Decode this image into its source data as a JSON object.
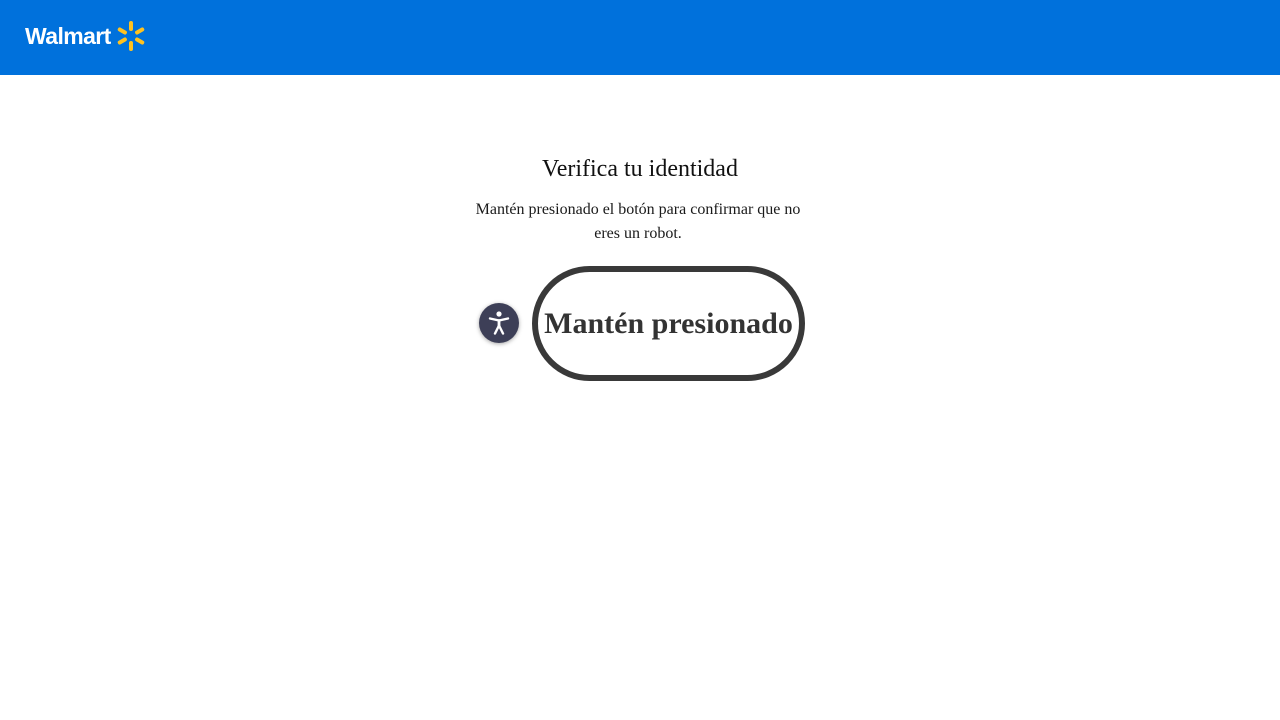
{
  "header": {
    "logo_text": "Walmart",
    "background_color": "#0071dc",
    "spark_icon": "spark-icon",
    "spark_color": "#ffc220"
  },
  "main": {
    "title": "Verifica tu identidad",
    "instructions": "Mantén presionado el botón para confirmar que no eres un robot.",
    "accessibility_icon": "accessibility-icon",
    "hold_button_label": "Mantén presionado"
  }
}
